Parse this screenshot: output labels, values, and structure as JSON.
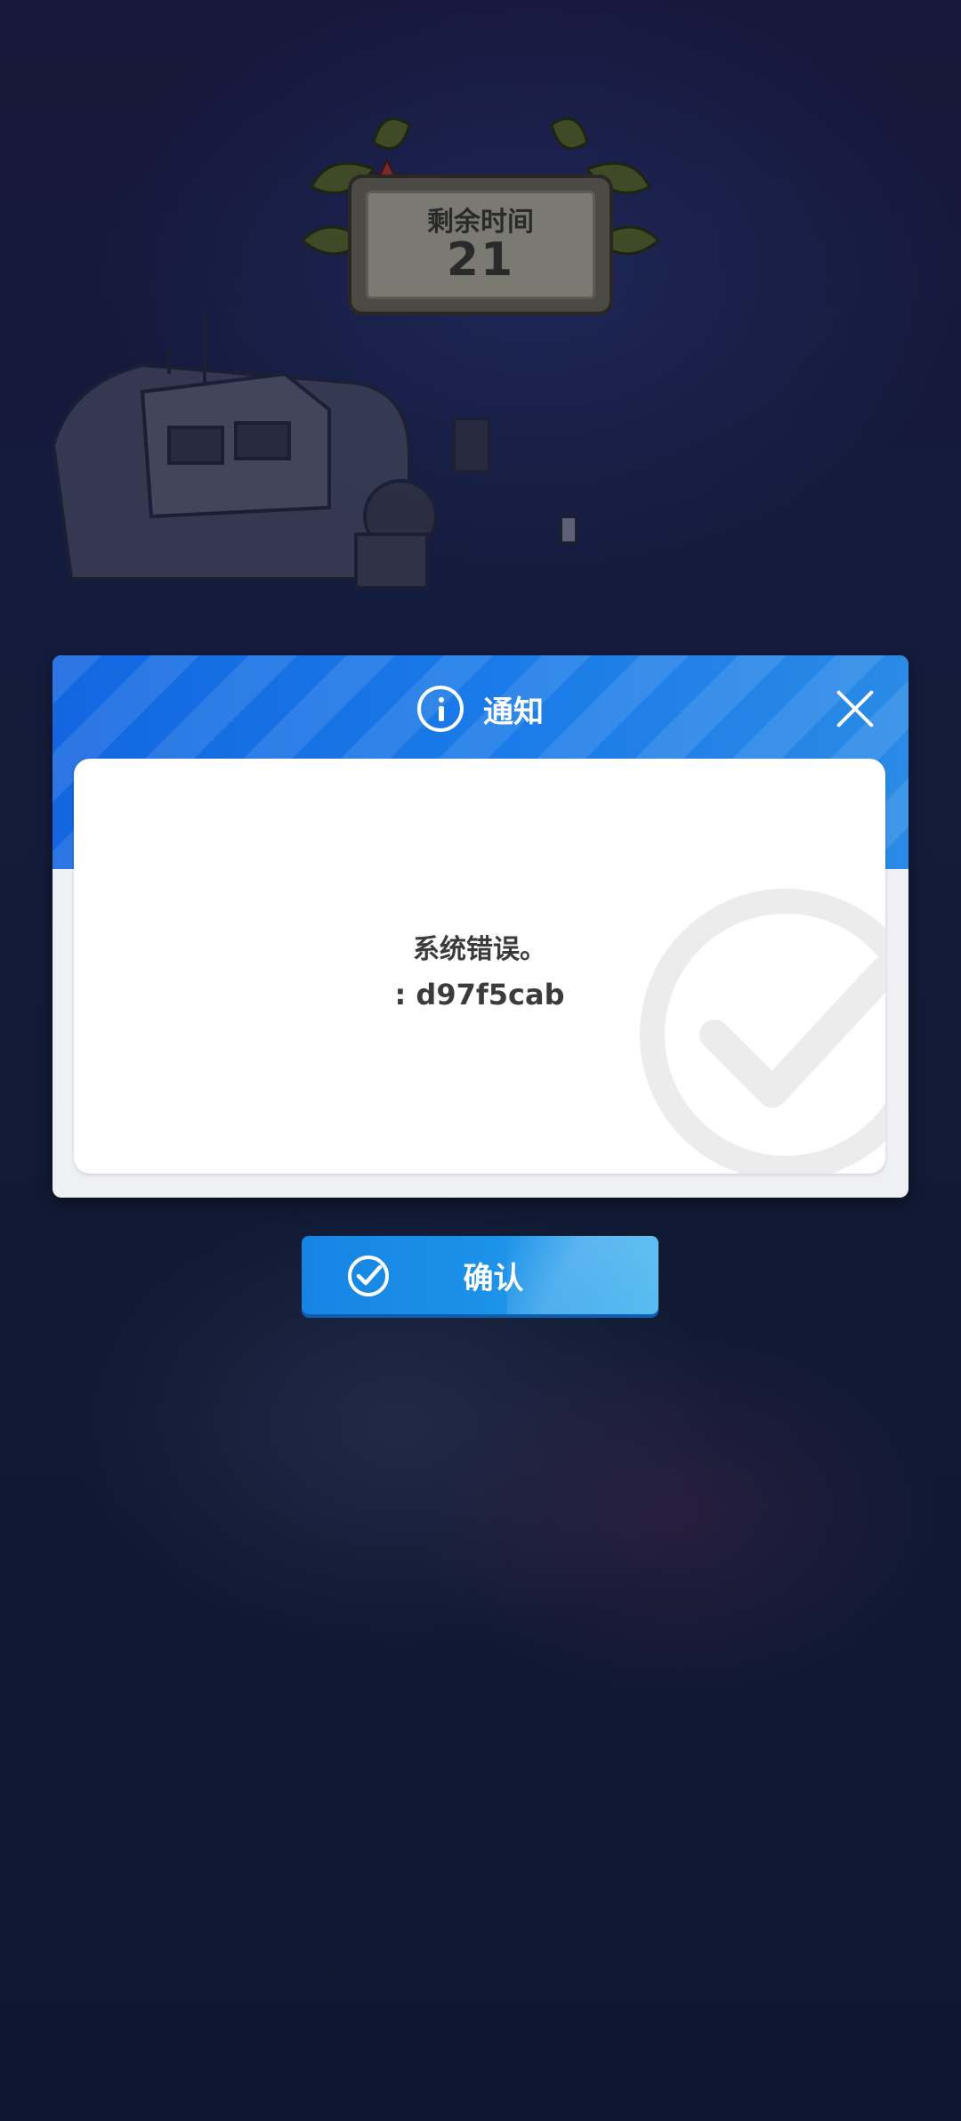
{
  "timer": {
    "label": "剩余时间",
    "value": "21"
  },
  "dialog": {
    "title": "通知",
    "message_line1": "系统错误。",
    "message_line2": ": d97f5cab"
  },
  "confirm": {
    "label": "确认"
  },
  "colors": {
    "header_blue": "#1a7ae8",
    "button_blue": "#1c92e8",
    "background": "#121a33"
  }
}
